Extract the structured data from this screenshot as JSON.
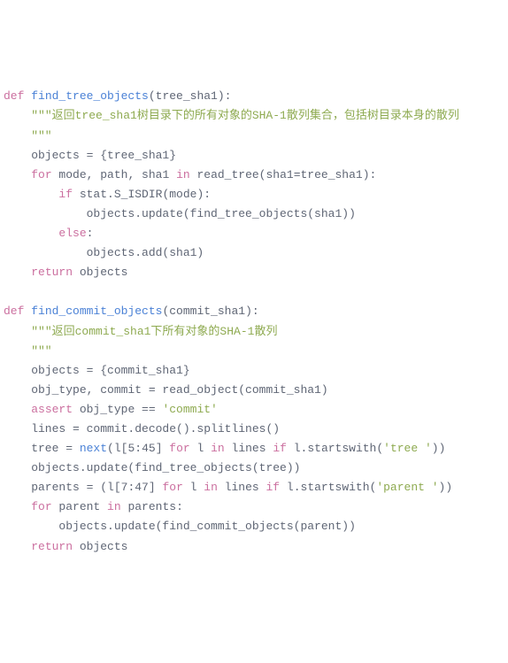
{
  "code": {
    "l1a": "def",
    "l1b": " ",
    "l1c": "find_tree_objects",
    "l1d": "(tree_sha1):",
    "l2a": "    ",
    "l2b": "\"\"\"返回tree_sha1树目录下的所有对象的SHA-1散列集合，包括树目录本身的散列",
    "l3a": "    \"\"\"",
    "l4a": "    objects = {tree_sha1}",
    "l5a": "    ",
    "l5b": "for",
    "l5c": " mode, path, sha1 ",
    "l5d": "in",
    "l5e": " read_tree(sha1=tree_sha1):",
    "l6a": "        ",
    "l6b": "if",
    "l6c": " stat.S_ISDIR(mode):",
    "l7a": "            objects.update(find_tree_objects(sha1))",
    "l8a": "        ",
    "l8b": "else",
    "l8c": ":",
    "l9a": "            objects.add(sha1)",
    "l10a": "    ",
    "l10b": "return",
    "l10c": " objects",
    "l11a": "",
    "l12a": "def",
    "l12b": " ",
    "l12c": "find_commit_objects",
    "l12d": "(commit_sha1):",
    "l13a": "    ",
    "l13b": "\"\"\"返回commit_sha1下所有对象的SHA-1散列",
    "l14a": "    \"\"\"",
    "l15a": "    objects = {commit_sha1}",
    "l16a": "    obj_type, commit = read_object(commit_sha1)",
    "l17a": "    ",
    "l17b": "assert",
    "l17c": " obj_type == ",
    "l17d": "'commit'",
    "l18a": "    lines = commit.decode().splitlines()",
    "l19a": "    tree = ",
    "l19b": "next",
    "l19c": "(l[",
    "l19d": "5",
    "l19e": ":",
    "l19f": "45",
    "l19g": "] ",
    "l19h": "for",
    "l19i": " l ",
    "l19j": "in",
    "l19k": " lines ",
    "l19l": "if",
    "l19m": " l.startswith(",
    "l19n": "'tree '",
    "l19o": "))",
    "l20a": "    objects.update(find_tree_objects(tree))",
    "l21a": "    parents = (l[",
    "l21b": "7",
    "l21c": ":",
    "l21d": "47",
    "l21e": "] ",
    "l21f": "for",
    "l21g": " l ",
    "l21h": "in",
    "l21i": " lines ",
    "l21j": "if",
    "l21k": " l.startswith(",
    "l21l": "'parent '",
    "l21m": "))",
    "l22a": "    ",
    "l22b": "for",
    "l22c": " parent ",
    "l22d": "in",
    "l22e": " parents:",
    "l23a": "        objects.update(find_commit_objects(parent))",
    "l24a": "    ",
    "l24b": "return",
    "l24c": " objects"
  }
}
